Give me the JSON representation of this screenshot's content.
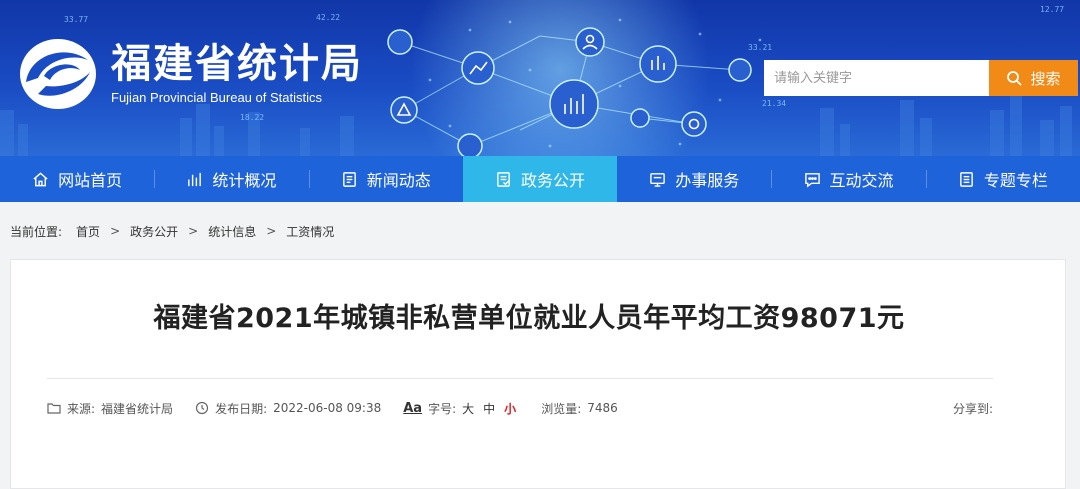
{
  "header": {
    "site_name_cn": "福建省统计局",
    "site_name_en": "Fujian Provincial Bureau of Statistics",
    "colors": {
      "banner_top": "#1136a8",
      "banner_bottom": "#2a6ad6",
      "search_button": "#f28a17"
    },
    "decor_numbers": [
      "33.77",
      "42.22",
      "33.21",
      "21.34",
      "18.22",
      "12.77"
    ],
    "search": {
      "placeholder": "请输入关键字",
      "value": "",
      "button_label": "搜索",
      "icon": "search-icon"
    }
  },
  "nav": {
    "colors": {
      "bar": "#1e63d9",
      "active": "#2fb7ea"
    },
    "items": [
      {
        "label": "网站首页",
        "icon": "home-icon"
      },
      {
        "label": "统计概况",
        "icon": "bar-chart-icon"
      },
      {
        "label": "新闻动态",
        "icon": "newspaper-icon"
      },
      {
        "label": "政务公开",
        "icon": "document-icon",
        "active": true
      },
      {
        "label": "办事服务",
        "icon": "monitor-icon"
      },
      {
        "label": "互动交流",
        "icon": "chat-icon"
      },
      {
        "label": "专题专栏",
        "icon": "list-icon"
      }
    ]
  },
  "breadcrumb": {
    "lead": "当前位置:",
    "items": [
      "首页",
      "政务公开",
      "统计信息",
      "工资情况"
    ],
    "separator": ">"
  },
  "article": {
    "title": "福建省2021年城镇非私营单位就业人员年平均工资98071元",
    "source_label": "来源:",
    "source": "福建省统计局",
    "date_label": "发布日期:",
    "date": "2022-06-08 09:38",
    "font_icon_text": "Aa",
    "font_size_label": "字号:",
    "font_size_options": [
      "大",
      "中",
      "小"
    ],
    "views_label": "浏览量:",
    "views": "7486",
    "share_label": "分享到:"
  }
}
